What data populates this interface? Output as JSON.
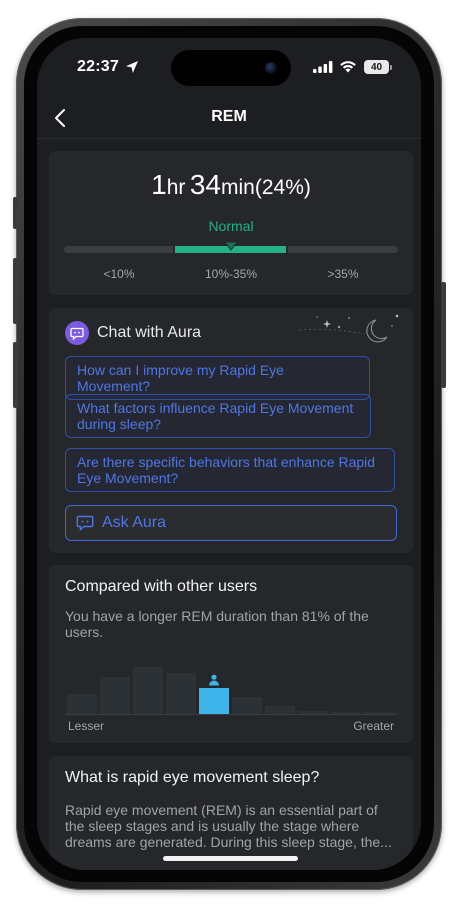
{
  "status": {
    "time": "22:37",
    "battery": "40"
  },
  "nav": {
    "title": "REM"
  },
  "duration": {
    "hours": "1",
    "hr_unit": "hr",
    "minutes": "34",
    "min_unit": "min",
    "percent": "(24%)",
    "status": "Normal",
    "ranges": [
      "<10%",
      "10%-35%",
      ">35%"
    ],
    "value_percent": 24
  },
  "chat": {
    "title": "Chat with Aura",
    "suggestions": [
      "How can I improve my Rapid Eye Movement?",
      "What factors influence Rapid Eye Movement during sleep?",
      "Are there specific behaviors that enhance Rapid Eye Movement?"
    ],
    "ask_label": "Ask Aura"
  },
  "compare": {
    "title": "Compared with other users",
    "text": "You have a longer REM duration than 81% of the users.",
    "low_label": "Lesser",
    "high_label": "Greater",
    "histogram": [
      0.42,
      0.78,
      1.0,
      0.88,
      0.55,
      0.36,
      0.17,
      0.07,
      0.03,
      0.02
    ],
    "user_bin": 4
  },
  "about": {
    "title": "What is rapid eye movement sleep?",
    "text": "Rapid eye movement (REM) is an essential part of the sleep stages and is usually the stage where dreams are generated. During this sleep stage, the..."
  },
  "colors": {
    "accent_green": "#22b285",
    "accent_blue": "#4e76e6",
    "highlight_cyan": "#3db4ea",
    "track_grey": "#3a3d42",
    "background": "#1d1e21",
    "card": "#25272a"
  }
}
